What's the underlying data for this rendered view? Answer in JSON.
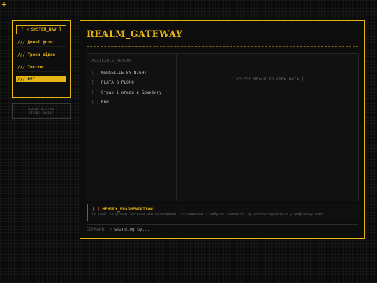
{
  "sidebar": {
    "title": "[ < SYSTEM_NAV ]",
    "items": [
      {
        "label": "/// Дивні фото"
      },
      {
        "label": "/// Треки відео"
      },
      {
        "label": "/// Тексти"
      },
      {
        "label": "/// RPI"
      }
    ],
    "sys_line1": "SERVER: RED_CORE",
    "sys_line2": "STATUS: ONLINE"
  },
  "main": {
    "title": "REALM_GATEWAY",
    "list_header": "AVAILABLE_REALMS:",
    "realms": [
      {
        "bracket": "[ ]",
        "name": "MARSEILLE BY NIGHT"
      },
      {
        "bracket": "[ ]",
        "name": "PLATA O PLOMO"
      },
      {
        "bracket": "[ ]",
        "name": "Страх і огида в Брюкінгу!"
      },
      {
        "bracket": "[ ]",
        "name": "RBN"
      }
    ],
    "placeholder": "[ SELECT REALM TO VIEW DATA ]"
  },
  "alert": {
    "prefix": "[!]",
    "title": "MEMORY_FRAGMENTATION:",
    "text": "Це наші загублені частини між проміжками, пісочницями і забутих кампаній, що розповсюджуються у цифровому шумі."
  },
  "command": {
    "label": "COMMAND: >",
    "value": "standing by..."
  },
  "colors": {
    "accent": "#e5b516",
    "alert": "#e05540",
    "background": "#0b0b0b"
  }
}
